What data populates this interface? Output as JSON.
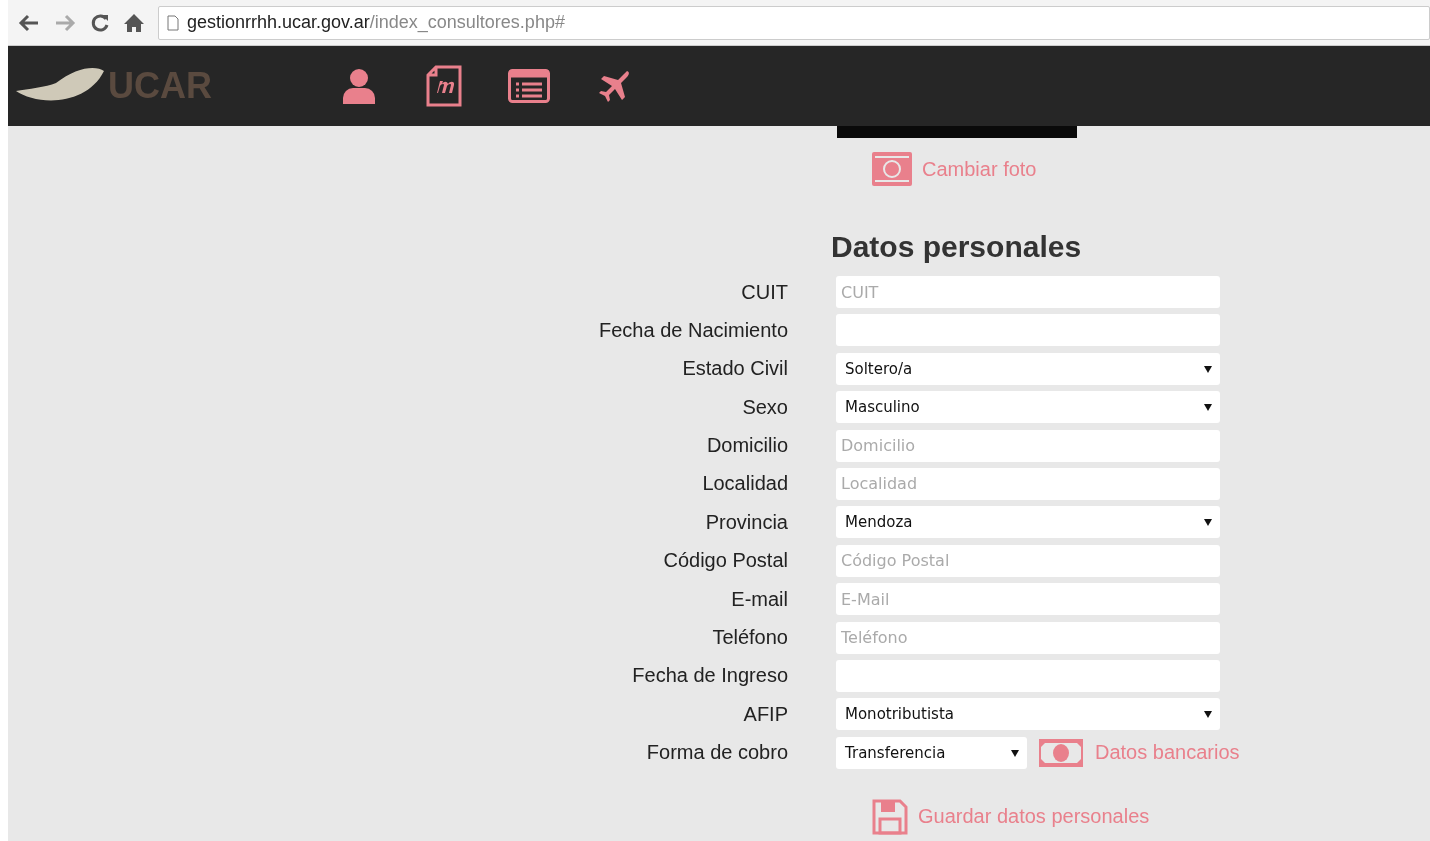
{
  "browser": {
    "url_host": "gestionrrhh.ucar.gov.ar",
    "url_path": "/index_consultores.php#"
  },
  "header": {
    "logo": "UCAR"
  },
  "photo": {
    "change_link": "Cambiar foto"
  },
  "form": {
    "title": "Datos personales",
    "fields": [
      {
        "label": "CUIT",
        "kind": "text",
        "placeholder": "CUIT"
      },
      {
        "label": "Fecha de Nacimiento",
        "kind": "text"
      },
      {
        "label": "Estado Civil",
        "kind": "select",
        "value": "Soltero/a"
      },
      {
        "label": "Sexo",
        "kind": "select",
        "value": "Masculino"
      },
      {
        "label": "Domicilio",
        "kind": "text",
        "placeholder": "Domicilio"
      },
      {
        "label": "Localidad",
        "kind": "text",
        "placeholder": "Localidad"
      },
      {
        "label": "Provincia",
        "kind": "select",
        "value": "Mendoza"
      },
      {
        "label": "Código Postal",
        "kind": "text",
        "placeholder": "Código Postal"
      },
      {
        "label": "E-mail",
        "kind": "text",
        "placeholder": "E-Mail"
      },
      {
        "label": "Teléfono",
        "kind": "text",
        "placeholder": "Teléfono"
      },
      {
        "label": "Fecha de Ingreso",
        "kind": "text"
      },
      {
        "label": "AFIP",
        "kind": "select",
        "value": "Monotributista"
      },
      {
        "label": "Forma de cobro",
        "kind": "select",
        "value": "Transferencia",
        "link": "Datos bancarios"
      }
    ],
    "save": "Guardar datos personales"
  }
}
